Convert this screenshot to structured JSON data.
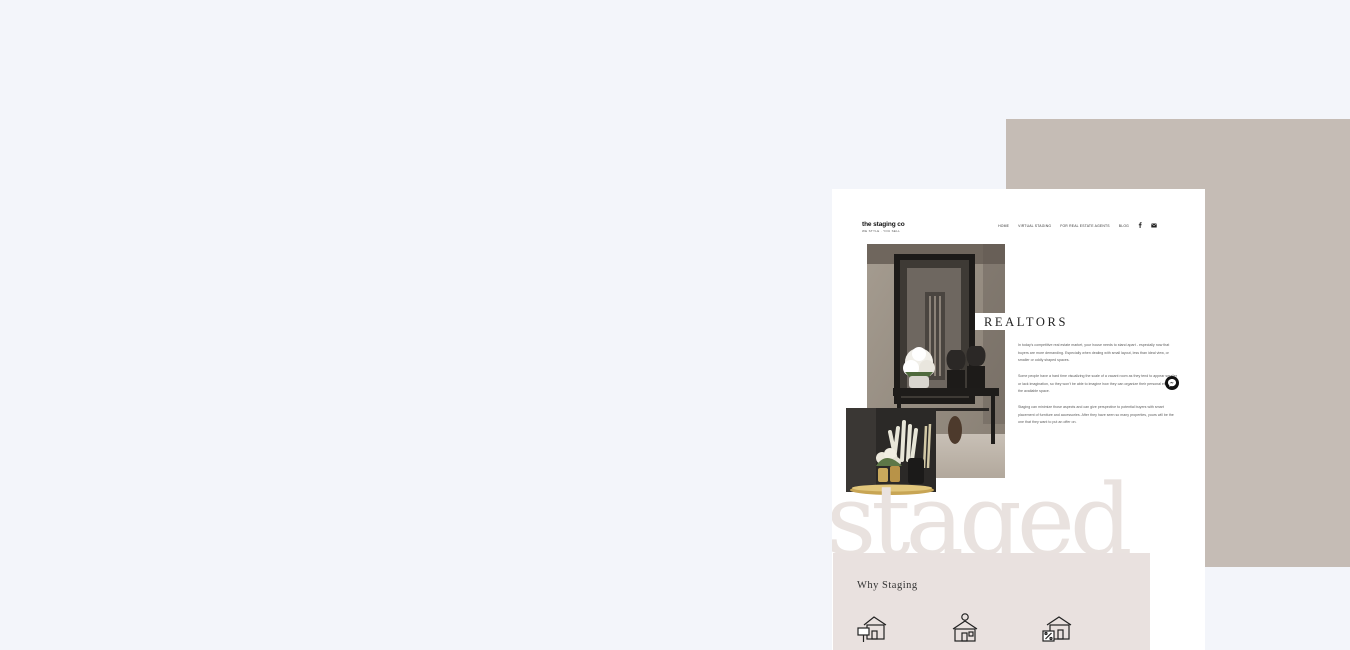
{
  "site": {
    "logo_main": "the staging co",
    "logo_tagline": "WE STYLE · YOU SELL",
    "nav": [
      "HOME",
      "VIRTUAL STAGING",
      "FOR REAL ESTATE AGENTS",
      "BLOG"
    ],
    "social_icons": [
      "facebook-icon",
      "mail-icon"
    ]
  },
  "hero": {
    "heading": "REALTORS",
    "paragraphs": [
      "In today's competitive real estate market, your house needs to stand apart - especially now that buyers are more demanding. Especially when dealing with small layout, less than ideal view, or smaller or oddly shaped spaces.",
      "Some people have a hard time visualizing the scale of a vacant room as they tend to appear smaller or lack imagination, so they won't be able to imagine how they can organize their personal effects in the available space.",
      "Staging can minimize those aspects and can give perspective to potential buyers with smart placement of furniture and accessories. After they have seen so many properties, yours will be the one that they want to put an offer on."
    ],
    "watermark": "staged"
  },
  "why": {
    "title": "Why Staging",
    "icons": [
      "house-for-sale-icon",
      "house-price-icon",
      "house-discount-icon"
    ]
  },
  "colors": {
    "background": "#f3f5fa",
    "accent_block": "#c5bcb5",
    "panel": "#e9e1df",
    "watermark": "#e9e2df"
  }
}
